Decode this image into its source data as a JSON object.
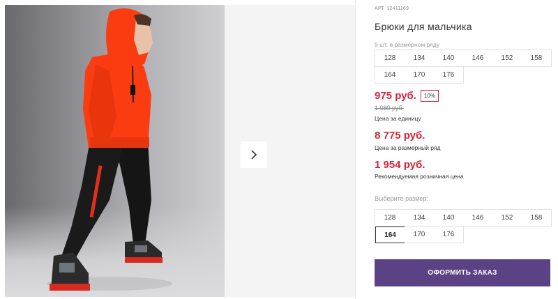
{
  "product": {
    "article": "АРТ. 12411169",
    "title": "Брюки для мальчика",
    "image_alt": "Мальчик в оранжевом худи и черных брюках"
  },
  "size_row": {
    "label": "9 шт. в размерном ряду",
    "sizes": [
      "128",
      "134",
      "140",
      "146",
      "152",
      "158",
      "164",
      "170",
      "176"
    ]
  },
  "pricing": {
    "unit_price": "975 руб.",
    "discount": "10%",
    "old_price": "1 080 руб.",
    "unit_caption": "Цена за единицу",
    "row_price": "8 775 руб.",
    "row_caption": "Цена за размерный ряд",
    "retail_price": "1 954 руб.",
    "retail_caption": "Рекомендуемая розничная цена"
  },
  "size_select": {
    "label": "Выберите размер:",
    "sizes": [
      "128",
      "134",
      "140",
      "146",
      "152",
      "158",
      "164",
      "170",
      "176"
    ],
    "selected": "164"
  },
  "actions": {
    "order_label": "ОФОРМИТЬ ЗАКАЗ"
  },
  "colors": {
    "price_red": "#d5223a",
    "button_purple": "#5a4285",
    "hoodie_orange": "#fb3c10"
  },
  "icons": {
    "next": "chevron-right-icon"
  }
}
